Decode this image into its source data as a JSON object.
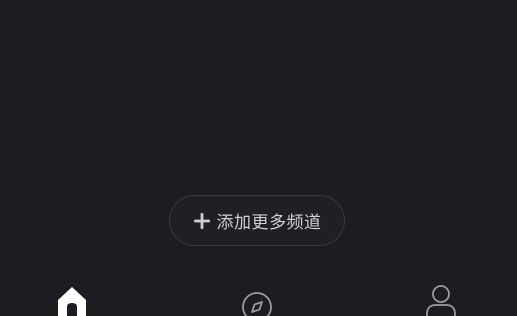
{
  "main": {
    "add_channel_label": "添加更多频道",
    "add_icon": "plus-icon"
  },
  "tabbar": {
    "tabs": [
      {
        "icon": "home-icon",
        "active": true
      },
      {
        "icon": "compass-icon",
        "active": false
      },
      {
        "icon": "person-icon",
        "active": false
      }
    ]
  },
  "colors": {
    "background": "#1c1d20",
    "text": "#cfd0d3",
    "active_icon": "#ffffff",
    "inactive_icon": "#9a9ba0"
  }
}
